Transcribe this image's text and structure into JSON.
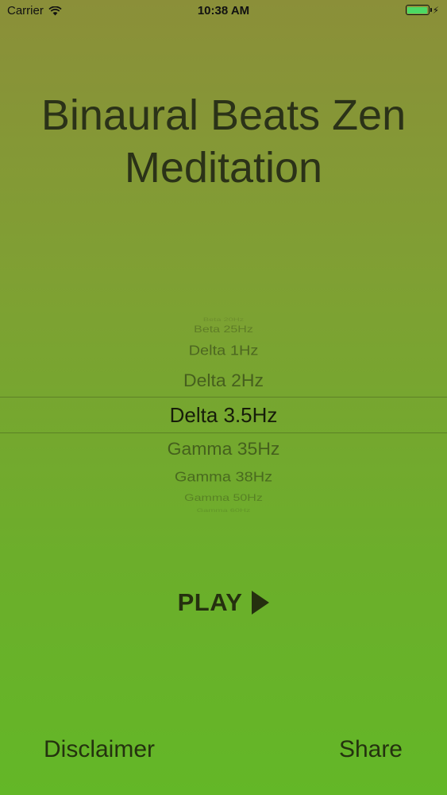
{
  "status_bar": {
    "carrier": "Carrier",
    "time": "10:38 AM",
    "battery_color": "#4cd964"
  },
  "app": {
    "title_line1": "Binaural Beats Zen",
    "title_line2": "Meditation"
  },
  "picker": {
    "items": [
      "Beta 20Hz",
      "Beta 25Hz",
      "Delta 1Hz",
      "Delta 2Hz",
      "Delta 3.5Hz",
      "Gamma 35Hz",
      "Gamma 38Hz",
      "Gamma 50Hz",
      "Gamma 60Hz"
    ],
    "selected": "Delta 3.5Hz"
  },
  "play_button": {
    "label": "PLAY",
    "icon": "play-triangle-icon"
  },
  "footer": {
    "disclaimer_label": "Disclaimer",
    "share_label": "Share"
  }
}
